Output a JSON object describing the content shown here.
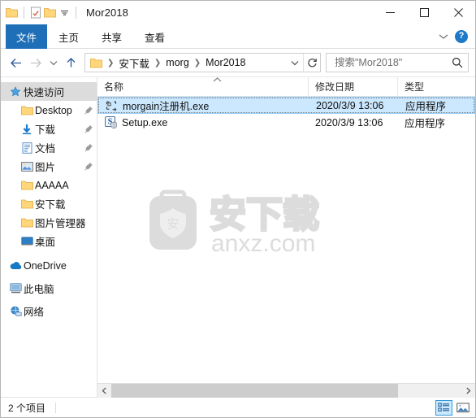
{
  "window": {
    "title": "Mor2018",
    "quick_access_icons": [
      "folder-icon",
      "properties-icon",
      "new-folder-icon",
      "customize-qat-caret-icon"
    ],
    "controls": {
      "minimize": "—",
      "maximize": "□",
      "close": "✕"
    }
  },
  "ribbon": {
    "tabs": [
      {
        "label": "文件",
        "active": true
      },
      {
        "label": "主页",
        "active": false
      },
      {
        "label": "共享",
        "active": false
      },
      {
        "label": "查看",
        "active": false
      }
    ],
    "collapse_icon": "chevron-down-icon",
    "help_label": "?"
  },
  "navbar": {
    "back_tooltip": "返回",
    "forward_tooltip": "前进",
    "recent_tooltip": "最近浏览的位置",
    "up_tooltip": "上移一级",
    "breadcrumbs": [
      "安下载",
      "morg",
      "Mor2018"
    ],
    "dropdown_icon": "chevron-down-icon",
    "refresh_icon": "refresh-icon"
  },
  "search": {
    "placeholder": "搜索\"Mor2018\"",
    "value": "",
    "icon": "search-icon"
  },
  "sidebar": {
    "items": [
      {
        "label": "快速访问",
        "icon": "star-pin-icon",
        "level": 0,
        "selected": true,
        "pinned": false
      },
      {
        "label": "Desktop",
        "icon": "folder-icon",
        "level": 1,
        "selected": false,
        "pinned": true
      },
      {
        "label": "下载",
        "icon": "downloads-icon",
        "level": 1,
        "selected": false,
        "pinned": true
      },
      {
        "label": "文档",
        "icon": "documents-icon",
        "level": 1,
        "selected": false,
        "pinned": true
      },
      {
        "label": "图片",
        "icon": "pictures-icon",
        "level": 1,
        "selected": false,
        "pinned": true
      },
      {
        "label": "AAAAA",
        "icon": "folder-icon",
        "level": 1,
        "selected": false,
        "pinned": false
      },
      {
        "label": "安下载",
        "icon": "folder-icon",
        "level": 1,
        "selected": false,
        "pinned": false
      },
      {
        "label": "图片管理器",
        "icon": "folder-icon",
        "level": 1,
        "selected": false,
        "pinned": false
      },
      {
        "label": "桌面",
        "icon": "desktop-icon",
        "level": 1,
        "selected": false,
        "pinned": false
      },
      {
        "label": "OneDrive",
        "icon": "onedrive-cloud-icon",
        "level": 0,
        "selected": false,
        "pinned": false
      },
      {
        "label": "此电脑",
        "icon": "this-pc-icon",
        "level": 0,
        "selected": false,
        "pinned": false
      },
      {
        "label": "网络",
        "icon": "network-icon",
        "level": 0,
        "selected": false,
        "pinned": false
      }
    ]
  },
  "filelist": {
    "columns": [
      {
        "key": "name",
        "label": "名称",
        "sorted": "asc"
      },
      {
        "key": "date",
        "label": "修改日期",
        "sorted": ""
      },
      {
        "key": "type",
        "label": "类型",
        "sorted": ""
      }
    ],
    "rows": [
      {
        "name": "morgain注册机.exe",
        "date": "2020/3/9 13:06",
        "type": "应用程序",
        "icon": "generic-exe-icon",
        "selected": true
      },
      {
        "name": "Setup.exe",
        "date": "2020/3/9 13:06",
        "type": "应用程序",
        "icon": "setup-shield-exe-icon",
        "selected": false
      }
    ]
  },
  "watermark": {
    "logo_char": "安",
    "text_cn": "安下载",
    "text_en": "anxz.com",
    "color": "#dcdcdc"
  },
  "statusbar": {
    "item_count": "2 个项目",
    "view_buttons": [
      {
        "name": "details-view",
        "icon": "details-view-icon",
        "active": true
      },
      {
        "name": "large-icons-view",
        "icon": "large-icons-view-icon",
        "active": false
      }
    ]
  },
  "scrollbar": {
    "left_arrow": "‹",
    "right_arrow": "›"
  },
  "colors": {
    "accent": "#1e6fb8",
    "selection": "#cce8ff",
    "folder": "#ffd77a",
    "help": "#1e79c8"
  }
}
